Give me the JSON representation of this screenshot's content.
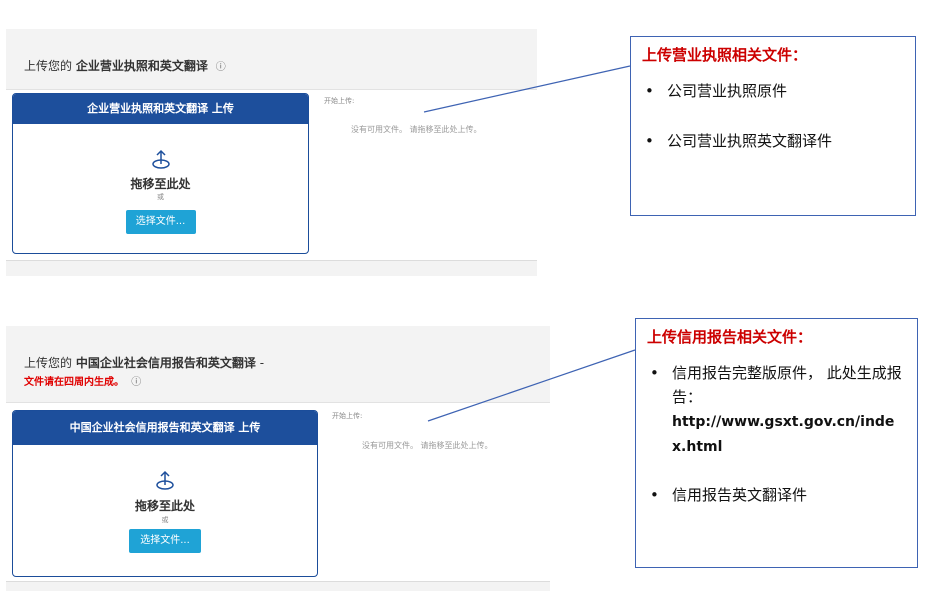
{
  "panel1": {
    "heading_prefix": "上传您的",
    "heading_bold": "企业营业执照和英文翻译",
    "info_icon": "ⓘ",
    "dropbox_title": "企业营业执照和英文翻译 上传",
    "drag_text": "拖移至此处",
    "or_text": "或",
    "choose_button": "选择文件...",
    "start_label": "开始上传:",
    "empty_message": "没有可用文件。 请拖移至此处上传。"
  },
  "panel2": {
    "heading_prefix": "上传您的",
    "heading_bold": "中国企业社会信用报告和英文翻译",
    "heading_suffix": "-",
    "note_red": "文件请在四周内生成。",
    "info_icon": "ⓘ",
    "dropbox_title": "中国企业社会信用报告和英文翻译 上传",
    "drag_text": "拖移至此处",
    "or_text": "或",
    "choose_button": "选择文件...",
    "start_label": "开始上传:",
    "empty_message": "没有可用文件。 请拖移至此处上传。"
  },
  "callout1": {
    "title": "上传营业执照相关文件：",
    "items": [
      "公司营业执照原件",
      "公司营业执照英文翻译件"
    ]
  },
  "callout2": {
    "title": "上传信用报告相关文件：",
    "item1_text": "信用报告完整版原件， 此处生成报告：",
    "item1_url": "http://www.gsxt.gov.cn/index.html",
    "item2_text": "信用报告英文翻译件"
  },
  "colors": {
    "header_blue": "#1d4f9c",
    "button_blue": "#1fa3d6",
    "callout_border": "#3e63b3",
    "callout_title_red": "#cc0000",
    "note_red": "#e00000"
  },
  "icons": {
    "upload": "upload-icon",
    "info": "info-icon"
  }
}
